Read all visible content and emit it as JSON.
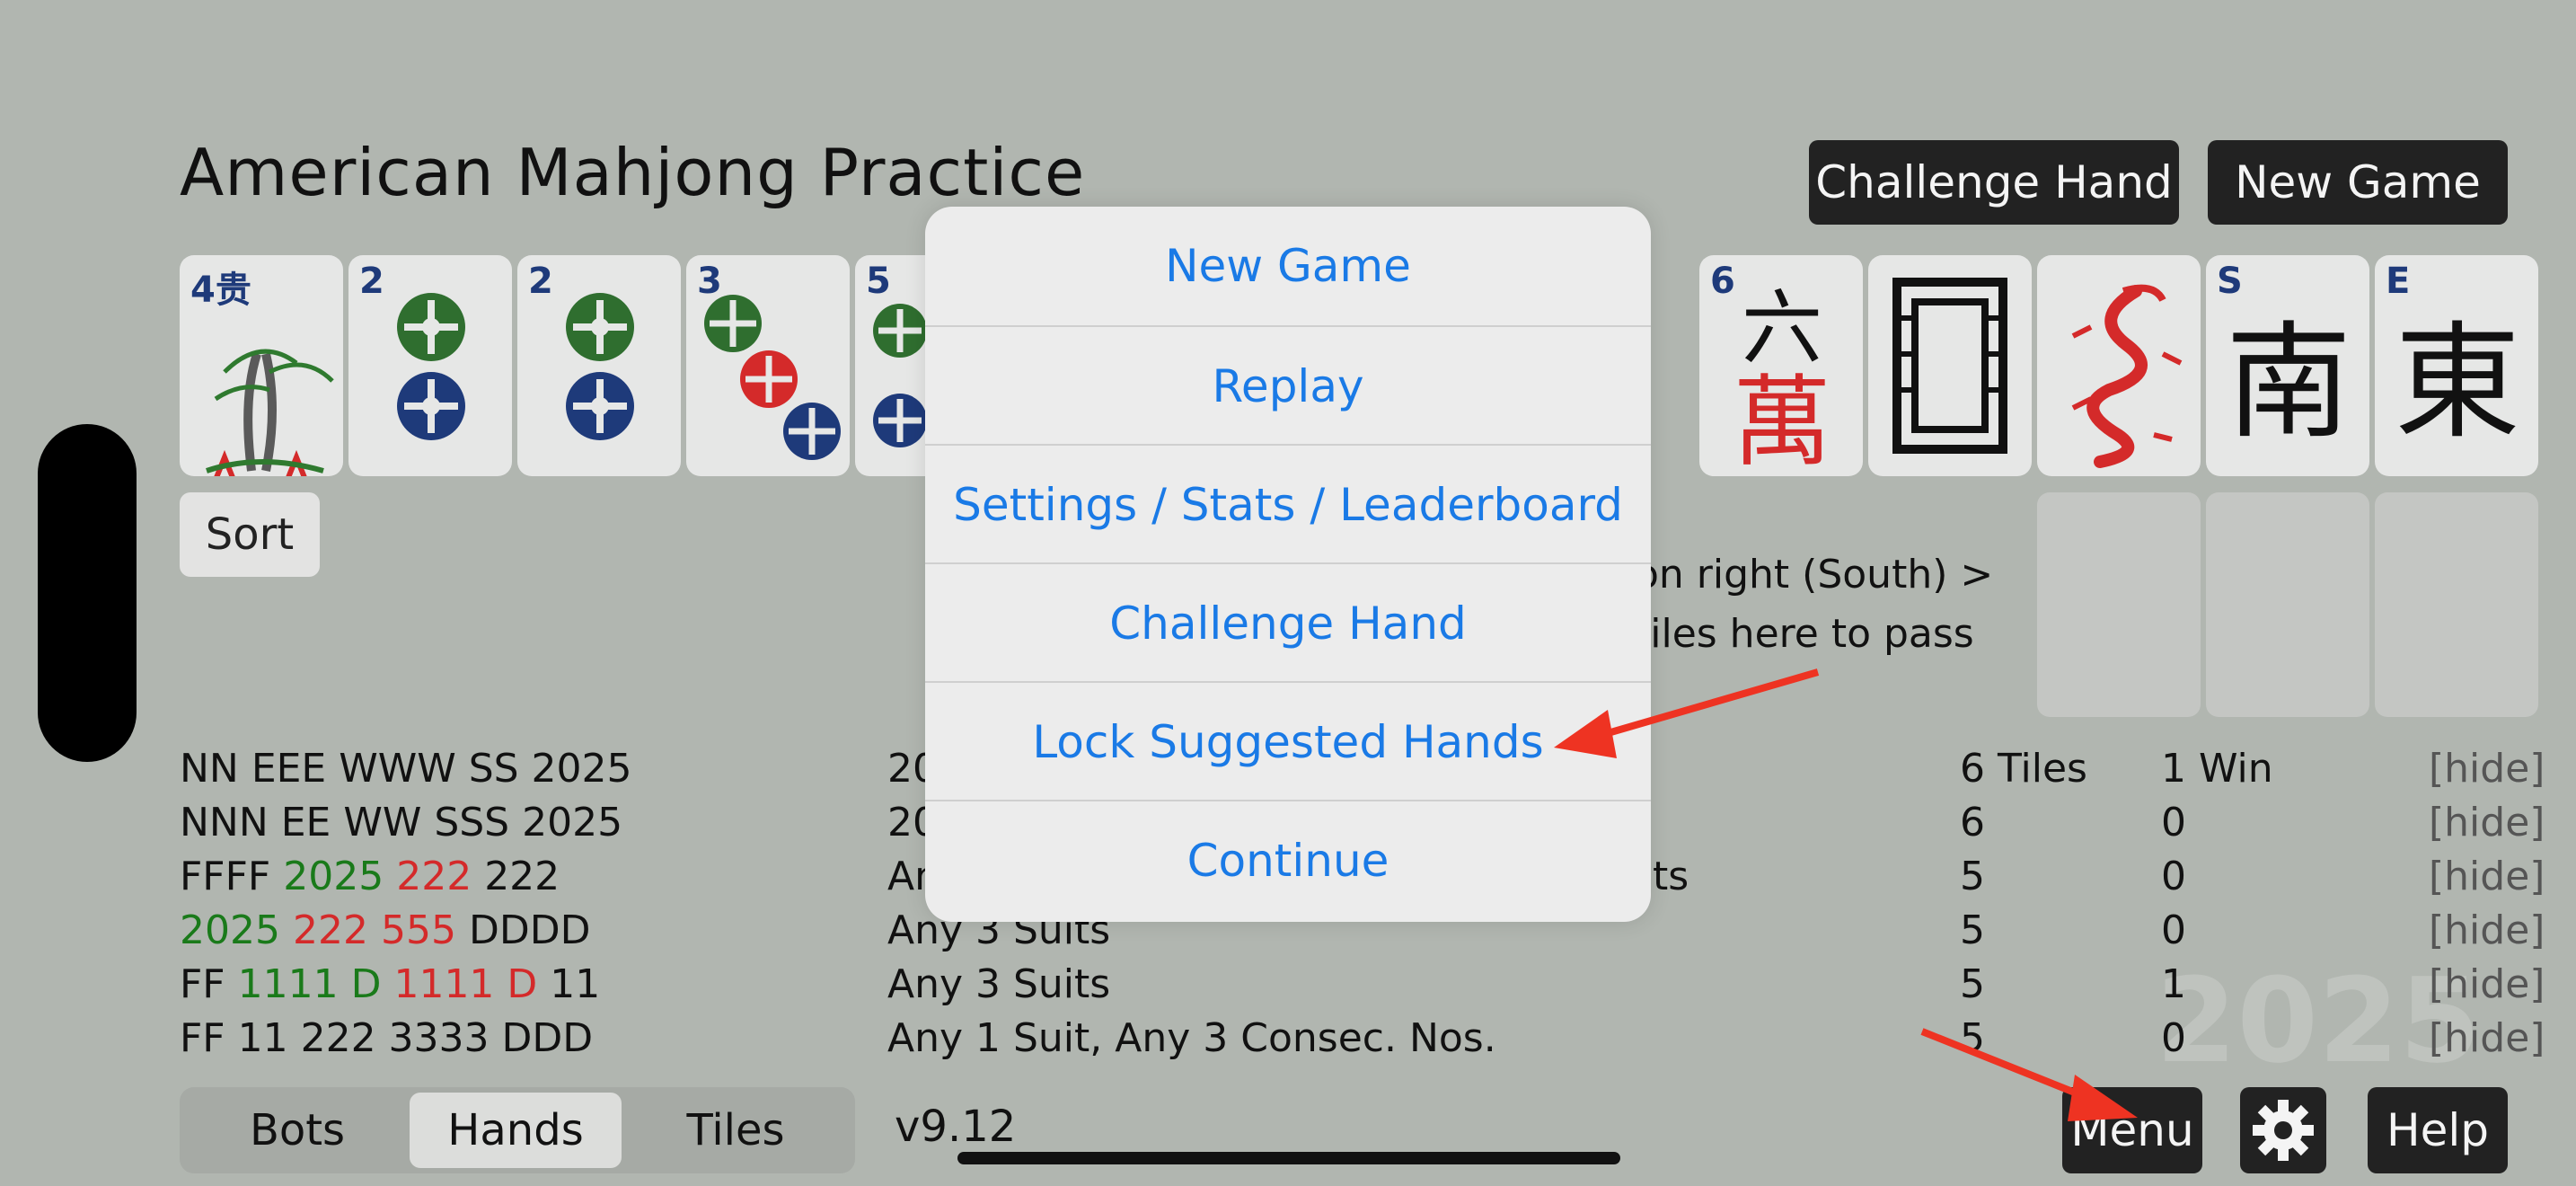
{
  "app": {
    "title": "American Mahjong Practice",
    "top_buttons": {
      "challenge": "Challenge Hand",
      "new_game": "New Game"
    }
  },
  "tiles": [
    {
      "corner": "4贵",
      "icon": "flower-tile"
    },
    {
      "corner": "2",
      "icon": "2-dots-tile"
    },
    {
      "corner": "2",
      "icon": "2-dots-tile"
    },
    {
      "corner": "3",
      "icon": "3-dots-tile"
    },
    {
      "corner": "5",
      "icon": "5-dots-tile"
    },
    {
      "corner": "6",
      "glyph_top": "六",
      "glyph_bottom": "萬",
      "icon": "6-crak-tile"
    },
    {
      "corner": "",
      "icon": "white-dragon-tile"
    },
    {
      "corner": "",
      "icon": "red-dragon-tile"
    },
    {
      "corner": "S",
      "glyph": "南",
      "icon": "south-wind-tile"
    },
    {
      "corner": "E",
      "glyph": "東",
      "icon": "east-wind-tile"
    }
  ],
  "sort_label": "Sort",
  "pass_text": {
    "line1": "on right (South) >",
    "line2": "tiles here to pass"
  },
  "hands": [
    {
      "pattern": [
        {
          "t": "NN EEE WWW SS 2025",
          "c": ""
        }
      ],
      "desc": "20",
      "tiles": "6 Tiles",
      "wins": "1 Win",
      "hide": "[hide]"
    },
    {
      "pattern": [
        {
          "t": "NNN EE WW SSS 2025",
          "c": ""
        }
      ],
      "desc": "20",
      "tiles": "6",
      "wins": "0",
      "hide": "[hide]"
    },
    {
      "pattern": [
        {
          "t": "FFFF ",
          "c": ""
        },
        {
          "t": "2025",
          "c": "green"
        },
        {
          "t": " ",
          "c": ""
        },
        {
          "t": "222",
          "c": "red"
        },
        {
          "t": " 222",
          "c": ""
        }
      ],
      "desc": "An",
      "desc_tail": "ts",
      "tiles": "5",
      "wins": "0",
      "hide": "[hide]"
    },
    {
      "pattern": [
        {
          "t": "2025",
          "c": "green"
        },
        {
          "t": " ",
          "c": ""
        },
        {
          "t": "222",
          "c": "red"
        },
        {
          "t": " ",
          "c": ""
        },
        {
          "t": "555",
          "c": "red"
        },
        {
          "t": " DDDD",
          "c": ""
        }
      ],
      "desc": "Any 3 Suits",
      "tiles": "5",
      "wins": "0",
      "hide": "[hide]"
    },
    {
      "pattern": [
        {
          "t": "FF ",
          "c": ""
        },
        {
          "t": "1111 D",
          "c": "green"
        },
        {
          "t": " ",
          "c": ""
        },
        {
          "t": "1111 D",
          "c": "red"
        },
        {
          "t": " 11",
          "c": ""
        }
      ],
      "desc": "Any 3 Suits",
      "tiles": "5",
      "wins": "1",
      "hide": "[hide]"
    },
    {
      "pattern": [
        {
          "t": "FF 11 222 3333 DDD",
          "c": ""
        }
      ],
      "desc": "Any 1 Suit, Any 3 Consec. Nos.",
      "tiles": "5",
      "wins": "0",
      "hide": "[hide]"
    }
  ],
  "watermark": "2025",
  "tabs": [
    {
      "label": "Bots",
      "active": false
    },
    {
      "label": "Hands",
      "active": true
    },
    {
      "label": "Tiles",
      "active": false
    }
  ],
  "version": "v9.12",
  "bottom_buttons": {
    "menu": "Menu",
    "help": "Help"
  },
  "menu": {
    "items": [
      "New Game",
      "Replay",
      "Settings / Stats / Leaderboard",
      "Challenge Hand",
      "Lock Suggested Hands",
      "Continue"
    ]
  },
  "colors": {
    "background": "#b1b6b0",
    "menu_text": "#1a7ae6",
    "annotation_arrow": "#ee3322"
  }
}
